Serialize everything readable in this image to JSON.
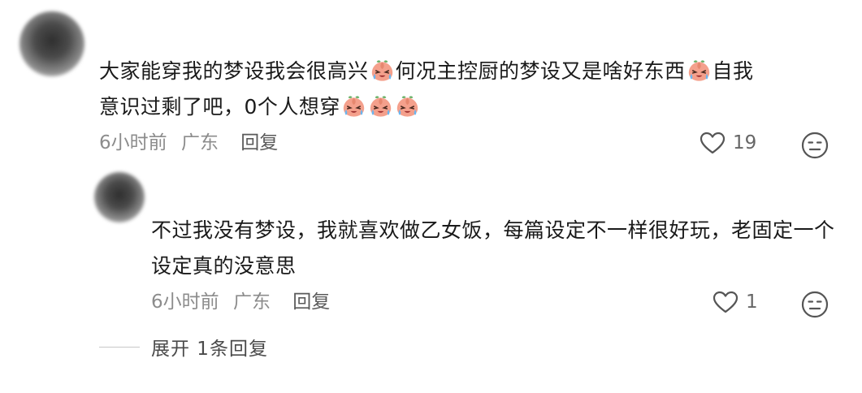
{
  "comment": {
    "text_line1_a": "大家能穿我的梦设我会很高兴",
    "text_line1_b": "何况主控厨的梦设又是啥好东西",
    "text_line1_c": "自我",
    "text_line2_a": "意识过剩了吧，0个人想穿",
    "time": "6小时前",
    "location": "广东",
    "reply_label": "回复",
    "like_count": "19",
    "emoji": "crying-peach-emoji"
  },
  "reply": {
    "text": "不过我没有梦设，我就喜欢做乙女饭，每篇设定不一样很好玩，老固定一个设定真的没意思",
    "time": "6小时前",
    "location": "广东",
    "reply_label": "回复",
    "like_count": "1"
  },
  "expand": {
    "label": "展开 1条回复"
  },
  "colors": {
    "text": "#1a1a1a",
    "meta": "#8c8c8c",
    "icon": "#555555"
  }
}
